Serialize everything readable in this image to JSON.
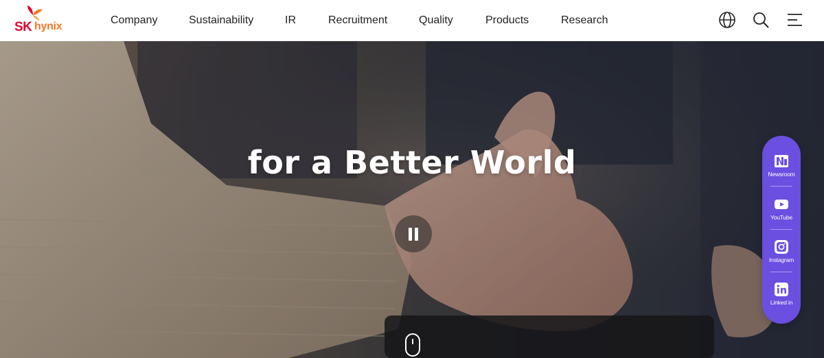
{
  "header": {
    "logo": {
      "sk": "SK",
      "hynix": "hynix"
    },
    "nav": [
      "Company",
      "Sustainability",
      "IR",
      "Recruitment",
      "Quality",
      "Products",
      "Research"
    ],
    "icons": [
      "globe-icon",
      "search-icon",
      "menu-icon"
    ]
  },
  "hero": {
    "title": "for a Better World",
    "pause_icon": "pause-icon",
    "scroll_icon": "mouse-scroll-icon"
  },
  "social": {
    "items": [
      {
        "label": "Newsroom",
        "icon": "newsroom-icon"
      },
      {
        "label": "YouTube",
        "icon": "youtube-icon"
      },
      {
        "label": "Instagram",
        "icon": "instagram-icon"
      },
      {
        "label": "Linked in",
        "icon": "linkedin-icon"
      }
    ]
  },
  "colors": {
    "brand_red": "#e4002b",
    "brand_orange": "#f47725",
    "social_bg": "#6a4fe0",
    "text_dark": "#222222"
  }
}
